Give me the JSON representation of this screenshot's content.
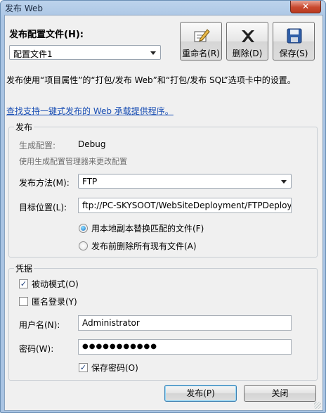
{
  "window": {
    "title": "发布 Web",
    "close_glyph": "✕"
  },
  "header": {
    "profile_label": "发布配置文件(H):",
    "profile_value": "配置文件1",
    "rename_label": "重命名(R)",
    "delete_label": "删除(D)",
    "save_label": "保存(S)"
  },
  "description": "发布使用“项目属性”的“打包/发布 Web”和“打包/发布 SQL”选项卡中的设置。",
  "link_text": "查找支持一键式发布的 Web 承载提供程序。",
  "publish": {
    "group_title": "发布",
    "build_config_label": "生成配置:",
    "build_config_value": "Debug",
    "build_hint": "使用生成配置管理器来更改配置",
    "method_label": "发布方法(M):",
    "method_value": "FTP",
    "target_label": "目标位置(L):",
    "target_value": "ftp://PC-SKYSOOT/WebSiteDeployment/FTPDeploy",
    "radio_replace": "用本地副本替换匹配的文件(F)",
    "radio_delete": "发布前删除所有现有文件(A)"
  },
  "credentials": {
    "group_title": "凭据",
    "passive_mode": "被动模式(O)",
    "anonymous": "匿名登录(Y)",
    "username_label": "用户名(N):",
    "username_value": "Administrator",
    "password_label": "密码(W):",
    "password_value": "●●●●●●●●●●●",
    "save_password": "保存密码(O)"
  },
  "footer": {
    "publish_label": "发布(P)",
    "close_label": "关闭"
  },
  "colors": {
    "link": "#1a4fb4",
    "titlebar": "#a9c4e3",
    "close": "#c8492f"
  }
}
